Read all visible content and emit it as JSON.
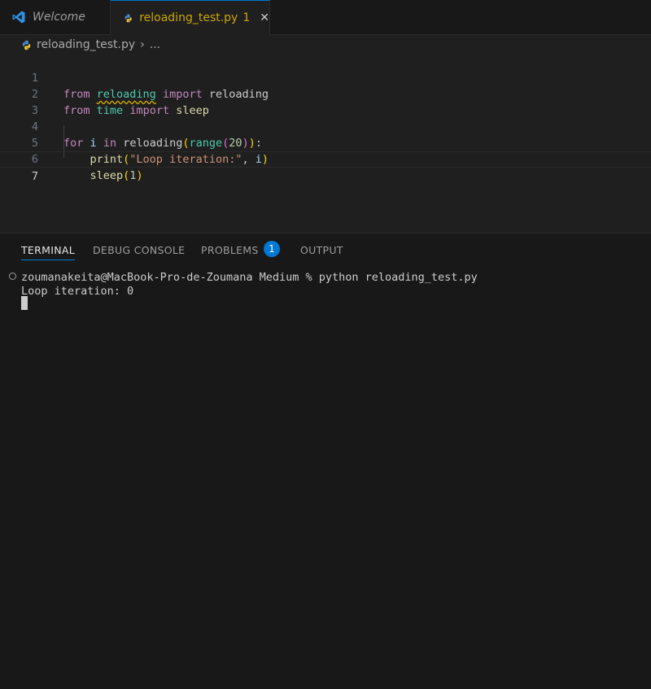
{
  "tabs": {
    "welcome": {
      "label": "Welcome"
    },
    "active": {
      "label": "reloading_test.py",
      "badge": "1",
      "close": "✕"
    }
  },
  "breadcrumb": {
    "file": "reloading_test.py",
    "separator": "›",
    "more": "..."
  },
  "editor": {
    "line_numbers": [
      "1",
      "2",
      "3",
      "4",
      "5",
      "6",
      "7"
    ],
    "lines": [
      "from reloading import reloading",
      "from time import sleep",
      "",
      "for i in reloading(range(20)):",
      "    print(\"Loop iteration:\", i)",
      "    sleep(1)",
      ""
    ],
    "current_line": 7
  },
  "panel": {
    "tabs": [
      "TERMINAL",
      "DEBUG CONSOLE",
      "PROBLEMS",
      "OUTPUT"
    ],
    "active_tab": "TERMINAL",
    "problems_count": "1",
    "terminal_lines": [
      "zoumanakeita@MacBook-Pro-de-Zoumana Medium % python reloading_test.py",
      "Loop iteration: 0"
    ]
  },
  "colors": {
    "accent": "#0078d4",
    "modified_tab": "#cca700",
    "background": "#1f1f1f"
  },
  "icons": [
    "vscode-logo-icon",
    "python-icon",
    "close-icon",
    "chevron-right-icon"
  ]
}
